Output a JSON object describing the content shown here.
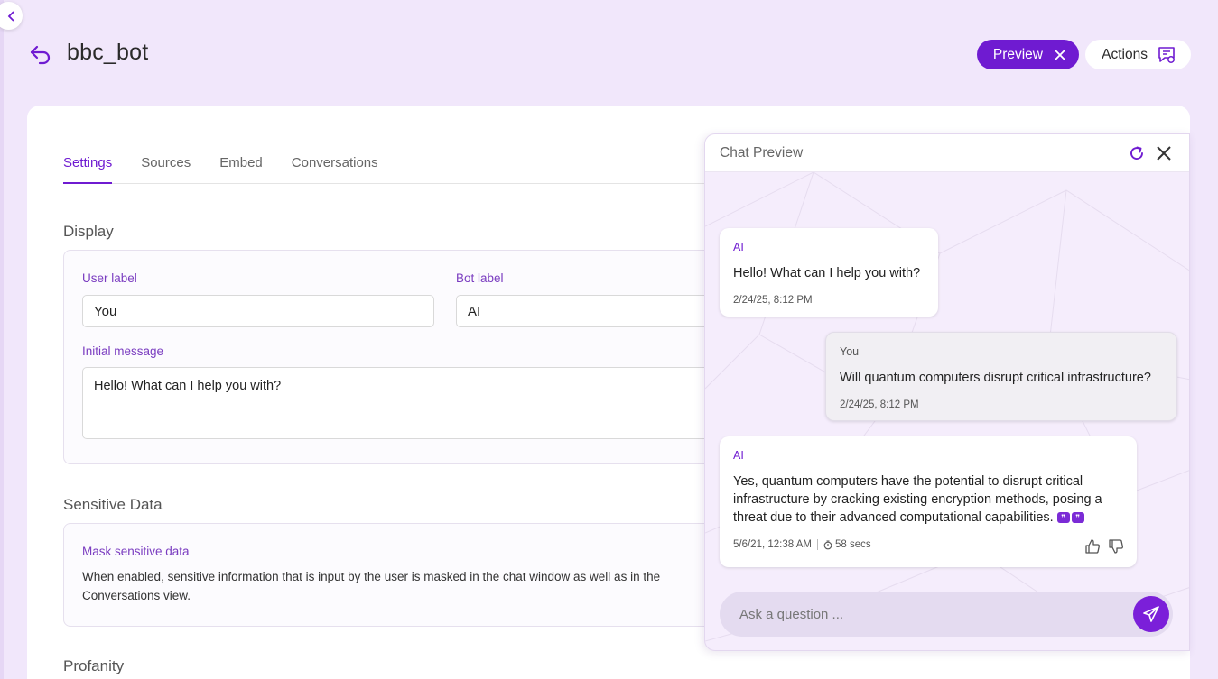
{
  "header": {
    "title": "bbc_bot",
    "preview_label": "Preview",
    "actions_label": "Actions"
  },
  "tabs": [
    {
      "label": "Settings",
      "active": true
    },
    {
      "label": "Sources",
      "active": false
    },
    {
      "label": "Embed",
      "active": false
    },
    {
      "label": "Conversations",
      "active": false
    }
  ],
  "display": {
    "title": "Display",
    "user_label_caption": "User label",
    "user_label_value": "You",
    "bot_label_caption": "Bot label",
    "bot_label_value": "AI",
    "initial_message_caption": "Initial message",
    "initial_message_value": "Hello! What can I help you with?"
  },
  "sensitive": {
    "title": "Sensitive Data",
    "mask_caption": "Mask sensitive data",
    "description": "When enabled, sensitive information that is input by the user is masked in the chat window as well as in the Conversations view."
  },
  "profanity": {
    "title": "Profanity"
  },
  "chat": {
    "title": "Chat Preview",
    "messages": [
      {
        "sender": "AI",
        "text": "Hello! What can I help you with?",
        "time": "2/24/25, 8:12 PM"
      },
      {
        "sender": "You",
        "text": "Will quantum computers disrupt critical infrastructure?",
        "time": "2/24/25, 8:12 PM"
      },
      {
        "sender": "AI",
        "text": "Yes, quantum computers have the potential to disrupt critical infrastructure by cracking existing encryption methods, posing a threat due to their advanced computational capabilities.",
        "time": "5/6/21, 12:38 AM",
        "duration": "58 secs"
      }
    ],
    "input_placeholder": "Ask a question ..."
  },
  "colors": {
    "accent": "#6f1bd1",
    "background": "#f1e7fb"
  }
}
